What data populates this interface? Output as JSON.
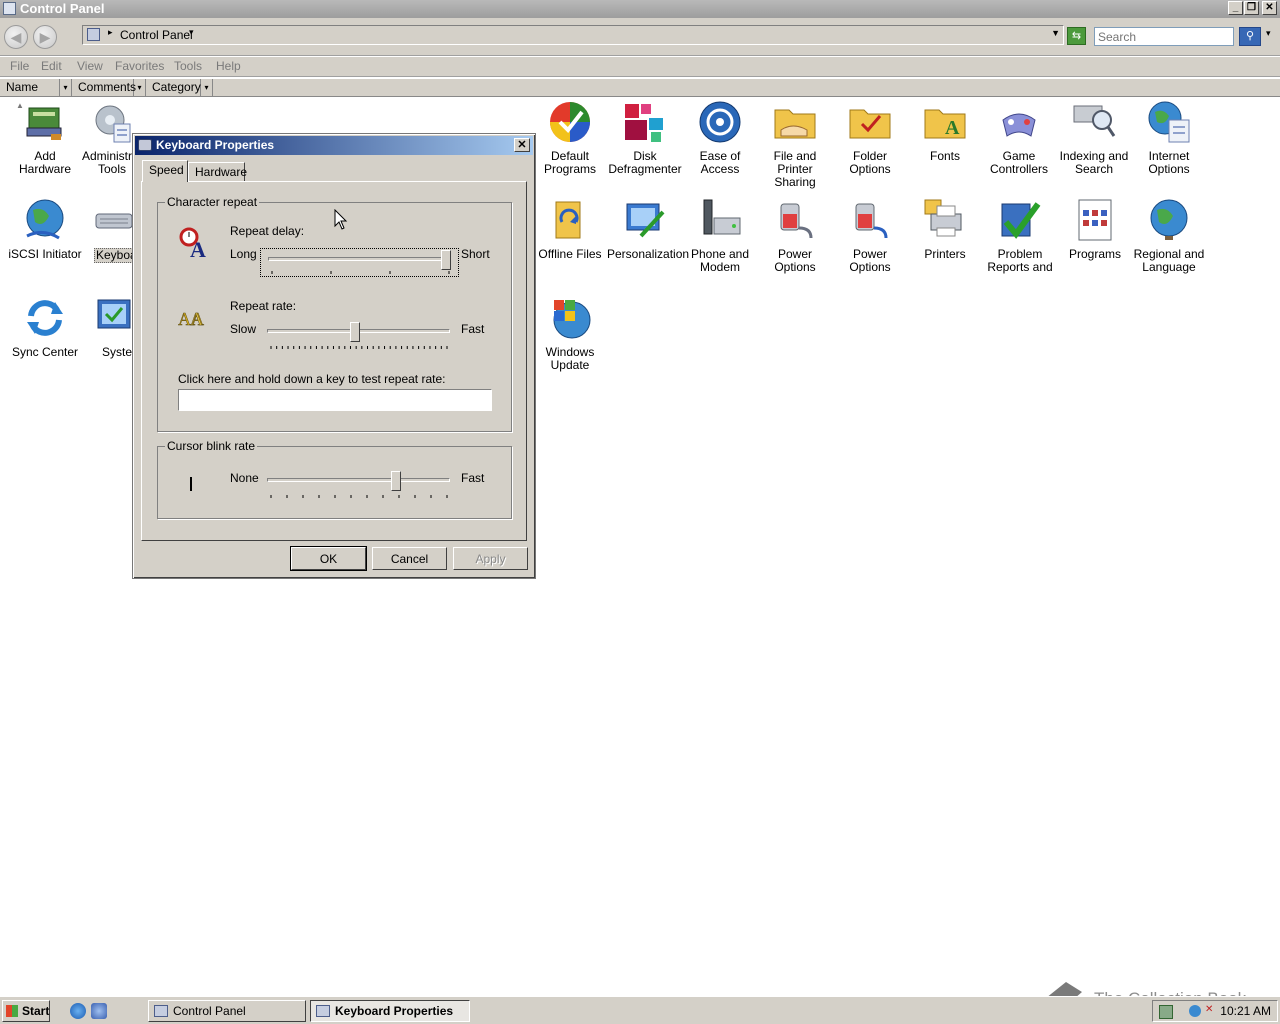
{
  "window": {
    "title": "Control Panel"
  },
  "address": {
    "path": "Control Panel",
    "search_placeholder": "Search"
  },
  "menu": [
    "File",
    "Edit",
    "View",
    "Favorites",
    "Tools",
    "Help"
  ],
  "columns": [
    "Name",
    "Comments",
    "Category"
  ],
  "icons": [
    {
      "label": "Add Hardware"
    },
    {
      "label": "Administrative\nTools"
    },
    {
      "label": "Default\nPrograms"
    },
    {
      "label": "Disk\nDefragmenter"
    },
    {
      "label": "Ease of\nAccess"
    },
    {
      "label": "File and Printer\nSharing"
    },
    {
      "label": "Folder Options"
    },
    {
      "label": "Fonts"
    },
    {
      "label": "Game\nControllers"
    },
    {
      "label": "Indexing and\nSearch"
    },
    {
      "label": "Internet\nOptions"
    },
    {
      "label": "iSCSI Initiator"
    },
    {
      "label": "Keyboard"
    },
    {
      "label": "Offline Files"
    },
    {
      "label": "Personalization"
    },
    {
      "label": "Phone and\nModem"
    },
    {
      "label": "Power Options"
    },
    {
      "label": "Power Options"
    },
    {
      "label": "Printers"
    },
    {
      "label": "Problem\nReports and"
    },
    {
      "label": "Programs"
    },
    {
      "label": "Regional and\nLanguage"
    },
    {
      "label": "Sync Center"
    },
    {
      "label": "System"
    },
    {
      "label": "Windows\nUpdate"
    }
  ],
  "dialog": {
    "title": "Keyboard Properties",
    "tabs": [
      "Speed",
      "Hardware"
    ],
    "character_repeat": {
      "title": "Character repeat",
      "delay_label": "Repeat delay:",
      "delay_min": "Long",
      "delay_max": "Short",
      "delay_value": 1.0,
      "rate_label": "Repeat rate:",
      "rate_min": "Slow",
      "rate_max": "Fast",
      "rate_value": 0.48,
      "test_label": "Click here and hold down a key to test repeat rate:",
      "test_value": ""
    },
    "cursor_blink": {
      "title": "Cursor blink rate",
      "min": "None",
      "max": "Fast",
      "value": 0.72
    },
    "buttons": {
      "ok": "OK",
      "cancel": "Cancel",
      "apply": "Apply"
    }
  },
  "taskbar": {
    "start": "Start",
    "tasks": [
      "Control Panel",
      "Keyboard Properties"
    ],
    "clock": "10:21 AM"
  },
  "watermark": "The Collection Book"
}
